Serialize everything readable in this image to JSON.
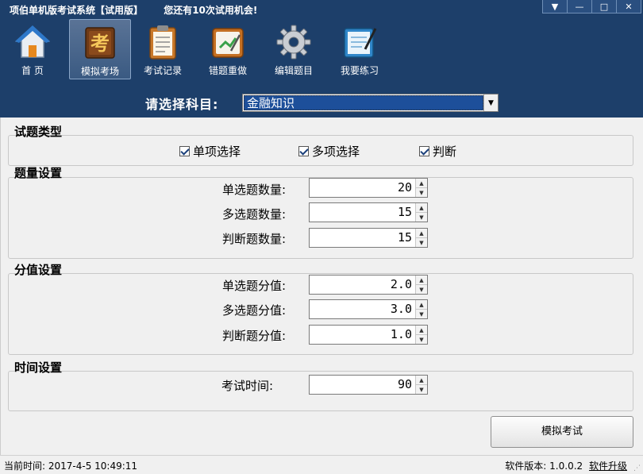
{
  "window": {
    "title": "项伯单机版考试系统【试用版】",
    "notice": "您还有10次试用机会!",
    "controls": [
      "▼",
      "—",
      "□",
      "✕"
    ]
  },
  "toolbar": [
    {
      "label": "首  页",
      "icon": "home-icon"
    },
    {
      "label": "模拟考场",
      "icon": "exam-icon",
      "active": true
    },
    {
      "label": "考试记录",
      "icon": "clipboard-icon"
    },
    {
      "label": "错题重做",
      "icon": "redo-notebook-icon"
    },
    {
      "label": "编辑题目",
      "icon": "gear-icon"
    },
    {
      "label": "我要练习",
      "icon": "practice-book-icon"
    }
  ],
  "subject": {
    "label": "请选择科目:",
    "value": "金融知识"
  },
  "question_types": {
    "title": "试题类型",
    "items": [
      {
        "label": "单项选择",
        "checked": true
      },
      {
        "label": "多项选择",
        "checked": true
      },
      {
        "label": "判断",
        "checked": true
      }
    ]
  },
  "quantity": {
    "title": "题量设置",
    "rows": [
      {
        "label": "单选题数量:",
        "value": "20"
      },
      {
        "label": "多选题数量:",
        "value": "15"
      },
      {
        "label": "判断题数量:",
        "value": "15"
      }
    ]
  },
  "scores": {
    "title": "分值设置",
    "rows": [
      {
        "label": "单选题分值:",
        "value": "2.0"
      },
      {
        "label": "多选题分值:",
        "value": "3.0"
      },
      {
        "label": "判断题分值:",
        "value": "1.0"
      }
    ]
  },
  "time": {
    "title": "时间设置",
    "rows": [
      {
        "label": "考试时间:",
        "value": "90"
      }
    ]
  },
  "start_button": "模拟考试",
  "status": {
    "current_time_label": "当前时间:",
    "current_time": "2017-4-5 10:49:11",
    "version_label": "软件版本:",
    "version": "1.0.0.2",
    "upgrade_link": "软件升级"
  },
  "colors": {
    "header_bg": "#1d3f6a",
    "panel_bg": "#f0f0f0",
    "selection_bg": "#1d4f9a"
  }
}
